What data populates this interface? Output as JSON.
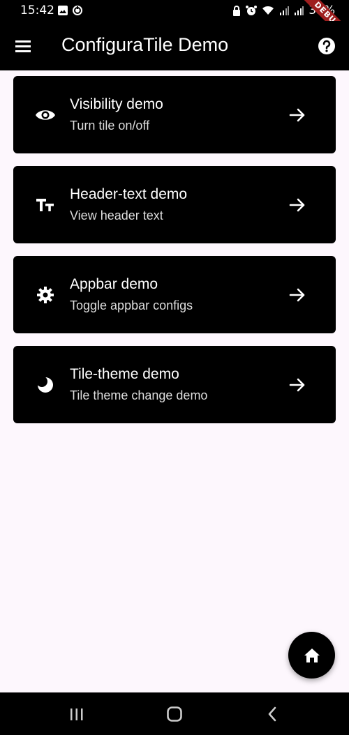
{
  "status_bar": {
    "time": "15:42",
    "battery": "39%",
    "left_icons": [
      "gallery-icon",
      "sync-icon"
    ],
    "right_icons": [
      "lock-icon",
      "alarm-icon",
      "wifi-icon",
      "signal-icon",
      "signal-icon"
    ]
  },
  "debug_banner": "DEBUG",
  "app_bar": {
    "title": "ConfiguraTile Demo",
    "menu_icon": "menu-icon",
    "help_icon": "help-icon"
  },
  "tiles": [
    {
      "title": "Visibility demo",
      "subtitle": "Turn tile on/off",
      "icon": "eye-icon"
    },
    {
      "title": "Header-text demo",
      "subtitle": "View header text",
      "icon": "text-icon"
    },
    {
      "title": "Appbar demo",
      "subtitle": "Toggle appbar configs",
      "icon": "gear-icon"
    },
    {
      "title": "Tile-theme demo",
      "subtitle": "Tile theme change demo",
      "icon": "moon-icon"
    }
  ],
  "fab_icon": "home-icon",
  "nav_bar": [
    "recents-icon",
    "home-nav-icon",
    "back-icon"
  ],
  "colors": {
    "app_bar": "#000000",
    "background": "#fdf7fd",
    "tile": "#000000",
    "debug": "#9e1f1f"
  }
}
